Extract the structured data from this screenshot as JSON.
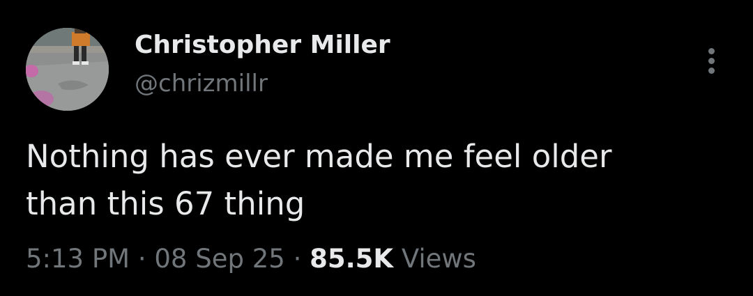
{
  "tweet": {
    "author": {
      "display_name": "Christopher Miller",
      "handle": "@chrizmillr",
      "avatar_icon": "profile-photo-person-standing"
    },
    "more_icon": "more-options-icon",
    "text_lines": [
      "Nothing has ever made me feel older",
      "than this 67 thing"
    ],
    "meta": {
      "time": "5:13 PM",
      "sep1": " · ",
      "date": "08 Sep 25",
      "sep2": " · ",
      "views_count": "85.5K",
      "views_label": " Views"
    },
    "colors": {
      "background": "#000000",
      "primary_text": "#e7e9ea",
      "secondary_text": "#71767b"
    }
  }
}
